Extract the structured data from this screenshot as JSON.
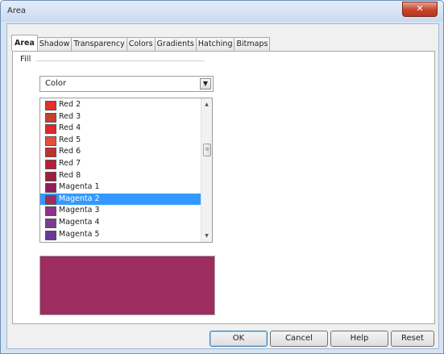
{
  "window": {
    "title": "Area",
    "close_glyph": "✕"
  },
  "tabs": [
    {
      "label": "Area",
      "active": true
    },
    {
      "label": "Shadow"
    },
    {
      "label": "Transparency"
    },
    {
      "label": "Colors"
    },
    {
      "label": "Gradients"
    },
    {
      "label": "Hatching"
    },
    {
      "label": "Bitmaps"
    }
  ],
  "fill": {
    "label": "Fill",
    "type_selected": "Color",
    "dropdown_arrow_icon": "chevron-down-icon",
    "colors": [
      {
        "name": "Red 2",
        "hex": "#e3302c"
      },
      {
        "name": "Red 3",
        "hex": "#c8402d"
      },
      {
        "name": "Red 4",
        "hex": "#e0272a"
      },
      {
        "name": "Red 5",
        "hex": "#e84f3b"
      },
      {
        "name": "Red 6",
        "hex": "#c23030"
      },
      {
        "name": "Red 7",
        "hex": "#b81e3a"
      },
      {
        "name": "Red 8",
        "hex": "#a01d3b"
      },
      {
        "name": "Magenta 1",
        "hex": "#8b1f5e"
      },
      {
        "name": "Magenta 2",
        "hex": "#9c2d5e",
        "selected": true
      },
      {
        "name": "Magenta 3",
        "hex": "#8e3388"
      },
      {
        "name": "Magenta 4",
        "hex": "#7a3d8e"
      },
      {
        "name": "Magenta 5",
        "hex": "#6a3a95"
      }
    ],
    "preview_color": "#9c2d5e"
  },
  "buttons": {
    "ok": "OK",
    "cancel": "Cancel",
    "help": "Help",
    "reset": "Reset"
  }
}
